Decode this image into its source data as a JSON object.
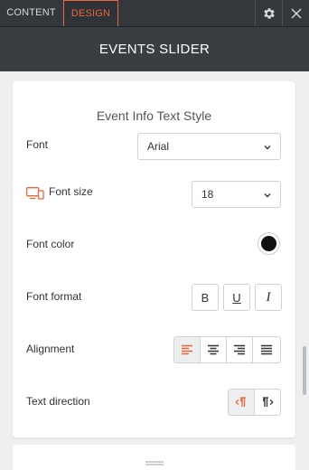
{
  "tabs": {
    "content": "CONTENT",
    "design": "DESIGN"
  },
  "header": {
    "title": "EVENTS SLIDER"
  },
  "section": {
    "title": "Event Info Text Style"
  },
  "font": {
    "label": "Font",
    "value": "Arial"
  },
  "font_size": {
    "label": "Font size",
    "value": "18"
  },
  "font_color": {
    "label": "Font color",
    "value": "#111111"
  },
  "font_format": {
    "label": "Font format",
    "buttons": [
      "B",
      "U",
      "I"
    ]
  },
  "alignment": {
    "label": "Alignment",
    "options": [
      "left",
      "center",
      "right",
      "justify"
    ],
    "selected": "left"
  },
  "text_direction": {
    "label": "Text direction",
    "options": [
      "ltr",
      "rtl"
    ],
    "selected": "ltr"
  },
  "colors": {
    "accent": "#e7683b",
    "toolbar": "#34383c",
    "header": "#3a3e42"
  }
}
